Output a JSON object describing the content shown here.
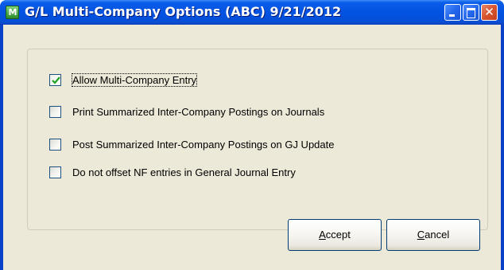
{
  "window": {
    "title": "G/L Multi-Company Options (ABC) 9/21/2012",
    "app_icon": "app-icon-mas",
    "controls": [
      "minimize-icon",
      "maximize-icon",
      "close-icon"
    ]
  },
  "options": {
    "items": [
      {
        "label": "Allow Multi-Company Entry",
        "checked": true,
        "focused": true
      },
      {
        "label": "Print Summarized Inter-Company Postings on Journals",
        "checked": false
      },
      {
        "label": "Post Summarized Inter-Company Postings on GJ Update",
        "checked": false
      },
      {
        "label": "Do not offset NF entries in General Journal Entry",
        "checked": false
      }
    ]
  },
  "buttons": {
    "accept": {
      "mnemonic": "A",
      "rest": "ccept"
    },
    "cancel": {
      "mnemonic": "C",
      "rest": "ancel"
    }
  },
  "colors": {
    "titlebar": "#0454e3",
    "dialog_bg": "#ece9d8",
    "close_button": "#d8542f",
    "checkbox_border": "#1c5180",
    "checkmark": "#21a121"
  }
}
